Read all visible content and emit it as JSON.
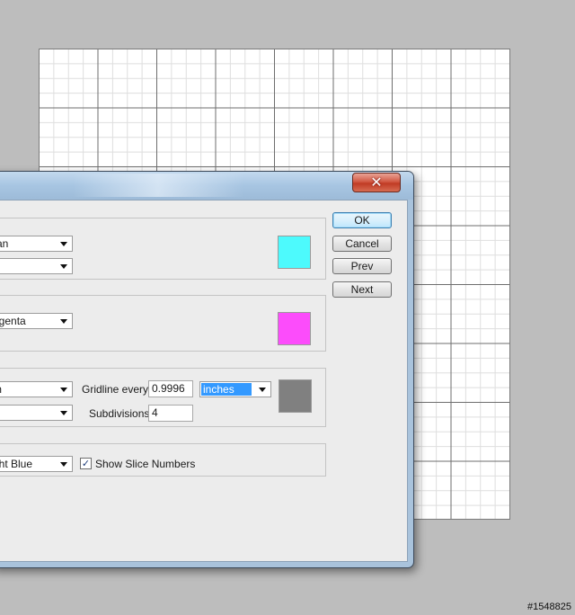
{
  "dialog": {
    "close_glyph": "✕"
  },
  "buttons": {
    "ok": "OK",
    "cancel": "Cancel",
    "prev": "Prev",
    "next": "Next"
  },
  "guides": {
    "color_value": "ran",
    "style_value": "",
    "swatch_color": "#4dfafd"
  },
  "smart_guides": {
    "color_value": "agenta",
    "swatch_color": "#fc4cfb"
  },
  "grid": {
    "color_value": "m",
    "style_value": "",
    "gridline_label": "Gridline every:",
    "gridline_value": "0.9996",
    "units_value": "inches",
    "subdivisions_label": "Subdivisions:",
    "subdivisions_value": "4",
    "swatch_color": "#808080"
  },
  "slices": {
    "line_color_value": "ght Blue",
    "show_numbers_label": "Show Slice Numbers",
    "show_numbers_checked": "✓"
  },
  "watermark": "#1548825"
}
